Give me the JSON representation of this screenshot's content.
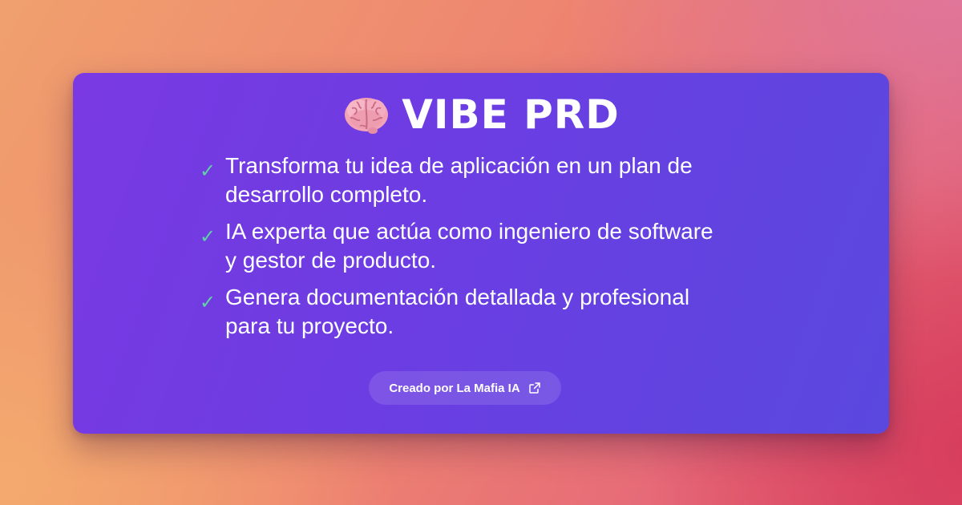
{
  "header": {
    "icon": "brain-icon",
    "title": "VIBE PRD"
  },
  "features": [
    {
      "icon": "check-icon",
      "text": "Transforma tu idea de aplicación en un plan de desarrollo completo."
    },
    {
      "icon": "check-icon",
      "text": "IA experta que actúa como ingeniero de software y gestor de producto."
    },
    {
      "icon": "check-icon",
      "text": "Genera documentación detallada y profesional para tu proyecto."
    }
  ],
  "footer": {
    "credit_label": "Creado por La Mafia IA",
    "credit_icon": "external-link-icon"
  },
  "colors": {
    "card_start": "#7a39e3",
    "card_end": "#5a48df",
    "check": "#5fd3a4",
    "text": "#ffffff"
  }
}
